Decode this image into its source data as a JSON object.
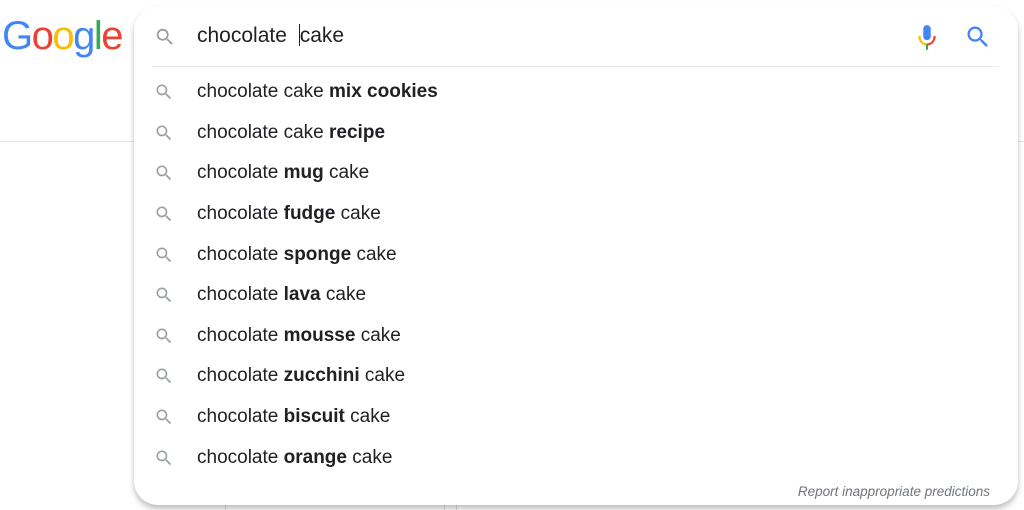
{
  "logo": {
    "letters": [
      {
        "char": "G",
        "color": "#4285F4"
      },
      {
        "char": "o",
        "color": "#EA4335"
      },
      {
        "char": "o",
        "color": "#FBBC05"
      },
      {
        "char": "g",
        "color": "#4285F4"
      },
      {
        "char": "l",
        "color": "#34A853"
      },
      {
        "char": "e",
        "color": "#EA4335"
      }
    ]
  },
  "search": {
    "query_before_caret": "chocolate ",
    "query_after_caret": "cake",
    "icon": "search-icon",
    "voice_icon": "microphone-icon",
    "submit_icon": "search-icon"
  },
  "suggestions": [
    {
      "prefix": "chocolate cake ",
      "bold": "mix cookies",
      "suffix": ""
    },
    {
      "prefix": "chocolate cake ",
      "bold": "recipe",
      "suffix": ""
    },
    {
      "prefix": "chocolate ",
      "bold": "mug",
      "suffix": " cake"
    },
    {
      "prefix": "chocolate ",
      "bold": "fudge",
      "suffix": " cake"
    },
    {
      "prefix": "chocolate ",
      "bold": "sponge",
      "suffix": " cake"
    },
    {
      "prefix": "chocolate ",
      "bold": "lava",
      "suffix": " cake"
    },
    {
      "prefix": "chocolate ",
      "bold": "mousse",
      "suffix": " cake"
    },
    {
      "prefix": "chocolate ",
      "bold": "zucchini",
      "suffix": " cake"
    },
    {
      "prefix": "chocolate ",
      "bold": "biscuit",
      "suffix": " cake"
    },
    {
      "prefix": "chocolate ",
      "bold": "orange",
      "suffix": " cake"
    }
  ],
  "footer": {
    "report_label": "Report inappropriate predictions"
  },
  "colors": {
    "blue": "#4285F4",
    "red": "#EA4335",
    "yellow": "#FBBC05",
    "green": "#34A853",
    "icon_gray": "#9aa0a6"
  }
}
